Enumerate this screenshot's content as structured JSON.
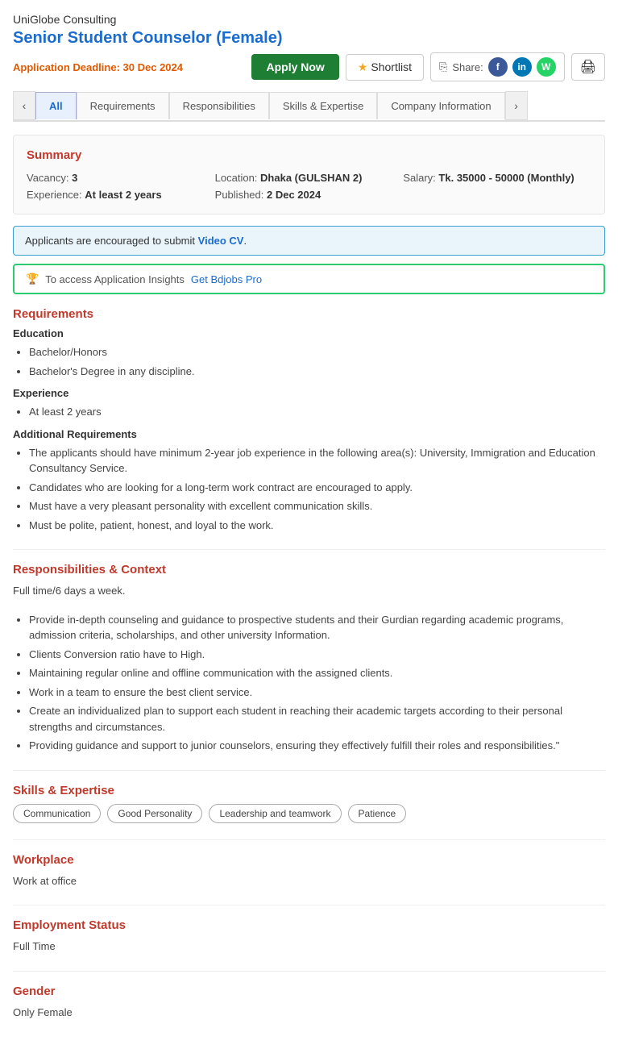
{
  "company": {
    "name": "UniGlobe Consulting"
  },
  "job": {
    "title": "Senior Student Counselor (Female)",
    "deadline_label": "Application Deadline:",
    "deadline_date": "30 Dec 2024"
  },
  "actions": {
    "apply_label": "Apply Now",
    "shortlist_label": "Shortlist",
    "share_label": "Share:"
  },
  "tabs": [
    {
      "id": "all",
      "label": "All",
      "active": true
    },
    {
      "id": "requirements",
      "label": "Requirements",
      "active": false
    },
    {
      "id": "responsibilities",
      "label": "Responsibilities",
      "active": false
    },
    {
      "id": "skills",
      "label": "Skills & Expertise",
      "active": false
    },
    {
      "id": "company",
      "label": "Company Information",
      "active": false
    }
  ],
  "summary": {
    "title": "Summary",
    "vacancy_label": "Vacancy:",
    "vacancy_value": "3",
    "location_label": "Location:",
    "location_value": "Dhaka (GULSHAN 2)",
    "salary_label": "Salary:",
    "salary_value": "Tk. 35000 - 50000 (Monthly)",
    "experience_label": "Experience:",
    "experience_value": "At least 2 years",
    "published_label": "Published:",
    "published_value": "2 Dec 2024"
  },
  "video_cv": {
    "text_before": "Applicants are encouraged to submit ",
    "link_text": "Video CV",
    "text_after": "."
  },
  "insights": {
    "text": "To access Application Insights ",
    "link_text": "Get Bdjobs Pro"
  },
  "requirements": {
    "section_title": "Requirements",
    "education_title": "Education",
    "education_items": [
      "Bachelor/Honors",
      "Bachelor's Degree in any discipline."
    ],
    "experience_title": "Experience",
    "experience_items": [
      "At least 2 years"
    ],
    "additional_title": "Additional Requirements",
    "additional_items": [
      "The applicants should have minimum 2-year job experience in the following area(s): University, Immigration and Education Consultancy Service.",
      "Candidates who are looking for a long-term work contract are encouraged to apply.",
      "Must have a very pleasant personality with excellent communication skills.",
      "Must be polite, patient, honest, and loyal to the work."
    ]
  },
  "responsibilities": {
    "section_title": "Responsibilities & Context",
    "intro": "Full time/6 days a week.",
    "items": [
      "Provide in-depth counseling and guidance to prospective students and their Gurdian regarding academic programs, admission criteria, scholarships, and other university Information.",
      "Clients Conversion ratio have to High.",
      "Maintaining regular online and offline communication with the assigned clients.",
      "Work in a team to ensure the best client service.",
      "Create an individualized plan to support each student in reaching their academic targets according to their personal strengths and circumstances.",
      "Providing guidance and support to junior counselors, ensuring they effectively fulfill their roles and responsibilities.\""
    ]
  },
  "skills": {
    "section_title": "Skills & Expertise",
    "items": [
      "Communication",
      "Good Personality",
      "Leadership and teamwork",
      "Patience"
    ]
  },
  "workplace": {
    "section_title": "Workplace",
    "value": "Work at office"
  },
  "employment": {
    "section_title": "Employment Status",
    "value": "Full Time"
  },
  "gender": {
    "section_title": "Gender",
    "value": "Only Female"
  }
}
